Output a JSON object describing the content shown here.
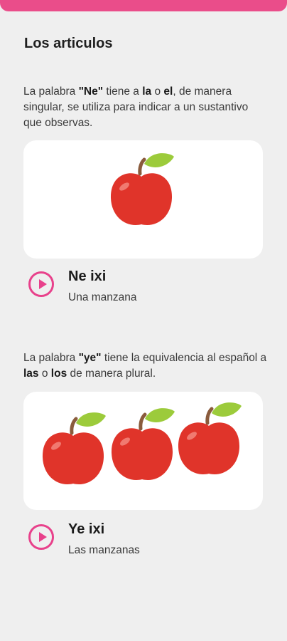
{
  "lesson": {
    "title": "Los articulos"
  },
  "section1": {
    "p1": "La palabra ",
    "term": "\"Ne\"",
    "p2": " tiene a ",
    "art1": "la",
    "p3": " o ",
    "art2": "el",
    "p4": ", de manera singular, se utiliza para indicar a un sustantivo que observas.",
    "image_icon": "apple-icon",
    "word": "Ne ixi",
    "translation": "Una manzana"
  },
  "section2": {
    "p1": "La palabra ",
    "term": "\"ye\"",
    "p2": " tiene la equivalencia al español a ",
    "art1": "las",
    "p3": " o ",
    "art2": "los",
    "p4": " de manera plural.",
    "image_icon": "apples-icon",
    "word": "Ye ixi",
    "translation": "Las manzanas"
  },
  "colors": {
    "accent": "#e8418b",
    "topbar": "#ea4d8a",
    "background": "#efefef",
    "card": "#ffffff",
    "apple": "#e0342a",
    "leaf": "#9ccb3b"
  }
}
